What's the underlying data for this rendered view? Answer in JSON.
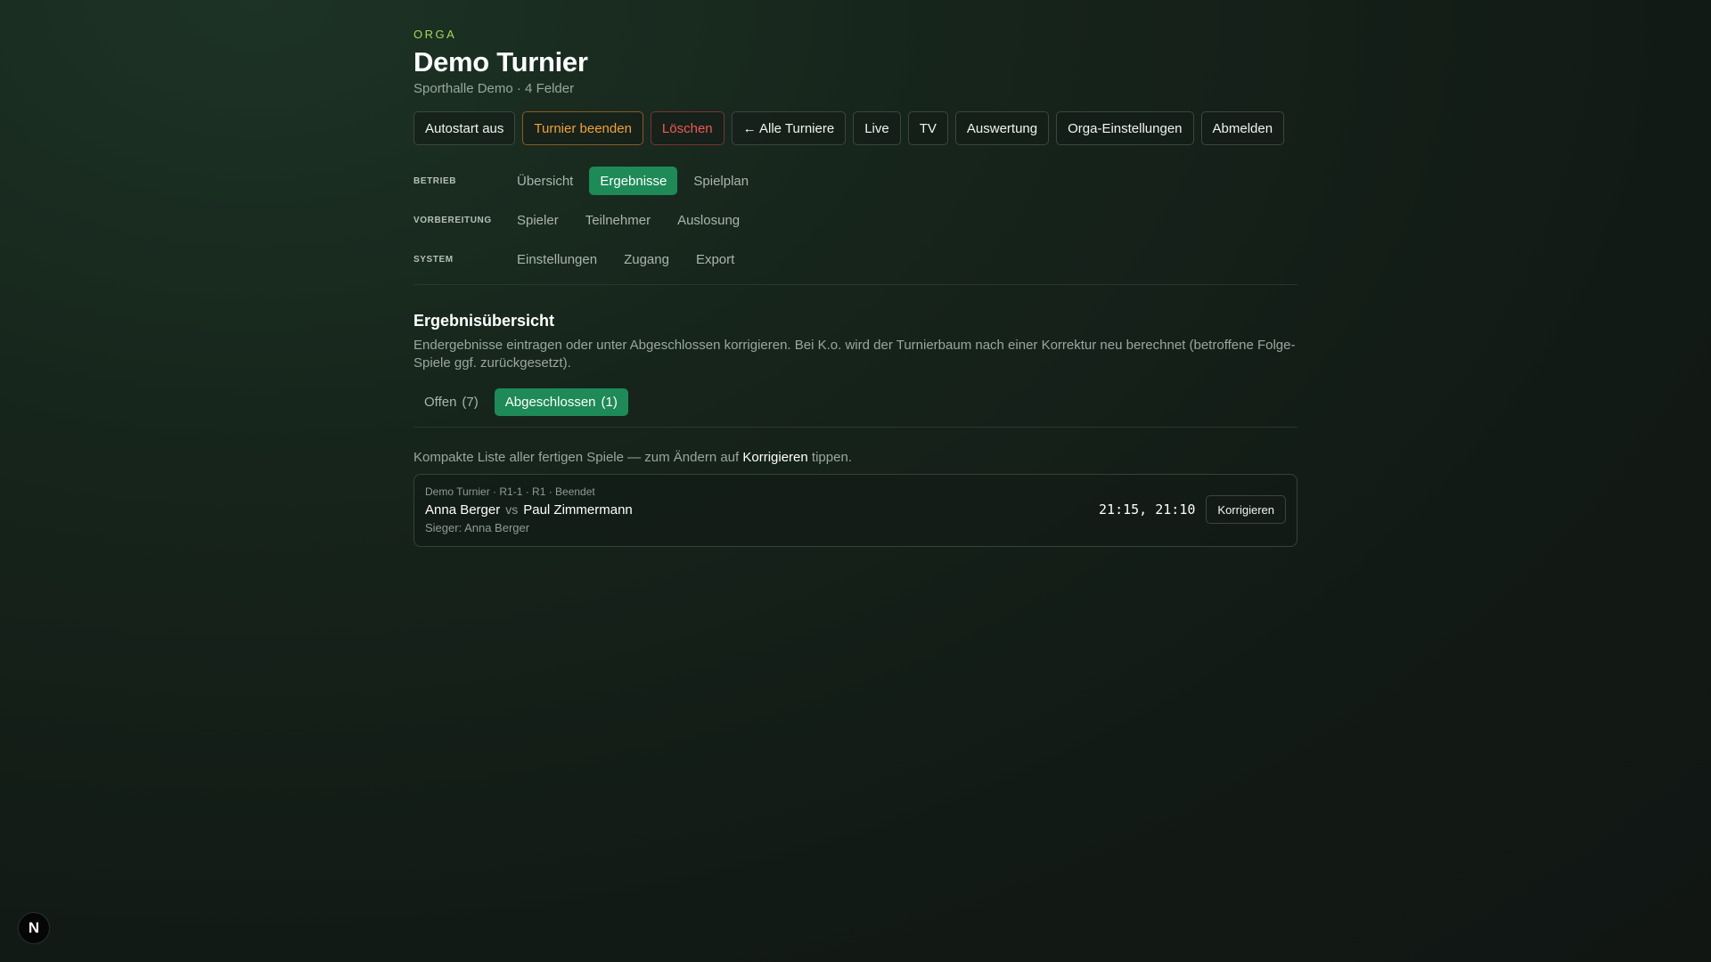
{
  "header": {
    "eyebrow": "ORGA",
    "title": "Demo Turnier",
    "subtitle": "Sporthalle Demo · 4 Felder"
  },
  "actions": [
    {
      "label": "Autostart aus",
      "variant": "default"
    },
    {
      "label": "Turnier beenden",
      "variant": "warn"
    },
    {
      "label": "Löschen",
      "variant": "danger"
    },
    {
      "label": "← Alle Turniere",
      "variant": "default"
    },
    {
      "label": "Live",
      "variant": "default"
    },
    {
      "label": "TV",
      "variant": "default"
    },
    {
      "label": "Auswertung",
      "variant": "default"
    },
    {
      "label": "Orga-Einstellungen",
      "variant": "default"
    },
    {
      "label": "Abmelden",
      "variant": "default"
    }
  ],
  "nav": {
    "betrieb": {
      "label": "BETRIEB",
      "items": [
        "Übersicht",
        "Ergebnisse",
        "Spielplan"
      ]
    },
    "vorbereitung": {
      "label": "VORBEREITUNG",
      "items": [
        "Spieler",
        "Teilnehmer",
        "Auslosung"
      ]
    },
    "system": {
      "label": "SYSTEM",
      "items": [
        "Einstellungen",
        "Zugang",
        "Export"
      ]
    },
    "active_item": "Ergebnisse"
  },
  "section": {
    "title": "Ergebnisübersicht",
    "description": "Endergebnisse eintragen oder unter Abgeschlossen korrigieren. Bei K.o. wird der Turnierbaum nach einer Korrektur neu berechnet (betroffene Folge-Spiele ggf. zurückgesetzt)."
  },
  "subtabs": {
    "open": {
      "label": "Offen",
      "count": "(7)"
    },
    "closed": {
      "label": "Abgeschlossen",
      "count": "(1)"
    },
    "active": "closed"
  },
  "list": {
    "hint_before": "Kompakte Liste aller fertigen Spiele — zum Ändern auf ",
    "hint_strong": "Korrigieren",
    "hint_after": " tippen."
  },
  "matches": [
    {
      "meta": "Demo Turnier · R1-1 · R1 · Beendet",
      "player_a": "Anna Berger",
      "vs": "vs",
      "player_b": "Paul Zimmermann",
      "winner": "Sieger: Anna Berger",
      "score": "21:15, 21:10",
      "action_label": "Korrigieren"
    }
  ],
  "fab": {
    "letter": "N"
  },
  "colors": {
    "accent": "#1e8a57",
    "eyebrow": "#a8d957",
    "warn": "#f0a23a",
    "danger": "#ee5a52"
  }
}
